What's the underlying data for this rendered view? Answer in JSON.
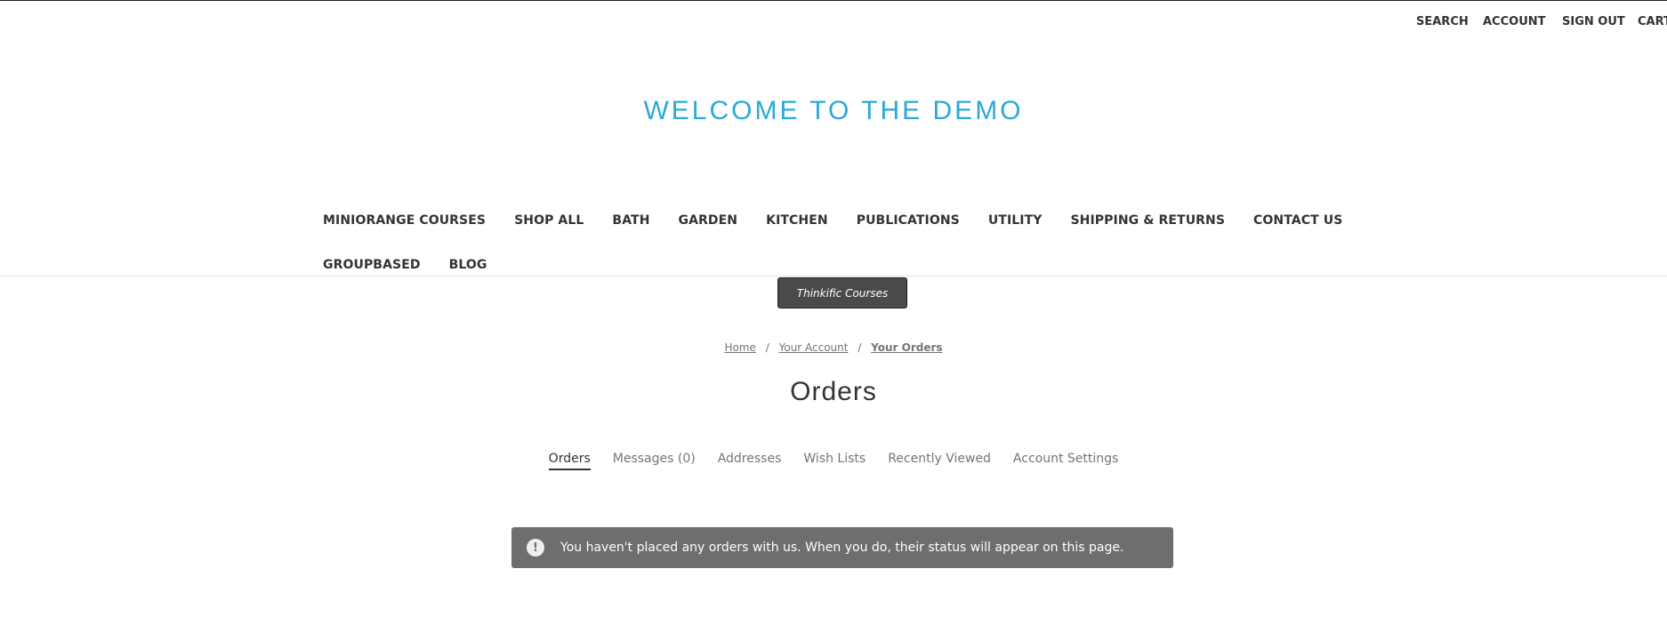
{
  "utility_nav": {
    "search": "SEARCH",
    "account": "ACCOUNT",
    "sign_out": "SIGN OUT",
    "cart": "CART"
  },
  "header": {
    "logo_text": "WELCOME TO THE DEMO"
  },
  "main_nav": {
    "row1": [
      "MINIORANGE COURSES",
      "SHOP ALL",
      "BATH",
      "GARDEN",
      "KITCHEN",
      "PUBLICATIONS",
      "UTILITY",
      "SHIPPING & RETURNS",
      "CONTACT US"
    ],
    "row2": [
      "GROUPBASED",
      "BLOG"
    ]
  },
  "tooltip": {
    "text": "Thinkific Courses"
  },
  "breadcrumb": {
    "items": [
      "Home",
      "Your Account",
      "Your Orders"
    ],
    "separator": "/"
  },
  "page": {
    "title": "Orders"
  },
  "account_tabs": {
    "items": [
      "Orders",
      "Messages (0)",
      "Addresses",
      "Wish Lists",
      "Recently Viewed",
      "Account Settings"
    ],
    "active": "Orders"
  },
  "alert": {
    "icon": "exclamation-icon",
    "message": "You haven't placed any orders with us. When you do, their status will appear on this page."
  },
  "colors": {
    "logo": "#2ba9d6",
    "alert_bg": "#6e6e6e",
    "tooltip_bg": "#4a4a4a"
  }
}
